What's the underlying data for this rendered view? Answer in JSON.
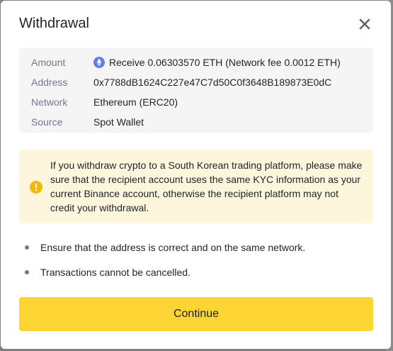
{
  "modal": {
    "title": "Withdrawal",
    "close_icon": "close-icon"
  },
  "details": {
    "amount_label": "Amount",
    "amount_value": "Receive 0.06303570 ETH (Network fee 0.0012 ETH)",
    "amount_icon": "ethereum-icon",
    "address_label": "Address",
    "address_value": "0x7788dB1624C227e47C7d50C0f3648B189873E0dC",
    "network_label": "Network",
    "network_value": "Ethereum (ERC20)",
    "source_label": "Source",
    "source_value": "Spot Wallet"
  },
  "warning": {
    "icon": "warning-icon",
    "text": "If you withdraw crypto to a South Korean trading platform, please make sure that the recipient account uses the same KYC information as your current Binance account, otherwise the recipient platform may not credit your withdrawal."
  },
  "notes": [
    "Ensure that the address is correct and on the same network.",
    "Transactions cannot be cancelled."
  ],
  "continue_label": "Continue",
  "colors": {
    "accent": "#fcd535",
    "warning_bg": "#fdf6dd",
    "warning_icon": "#f0b90b",
    "eth_icon": "#627eea"
  }
}
